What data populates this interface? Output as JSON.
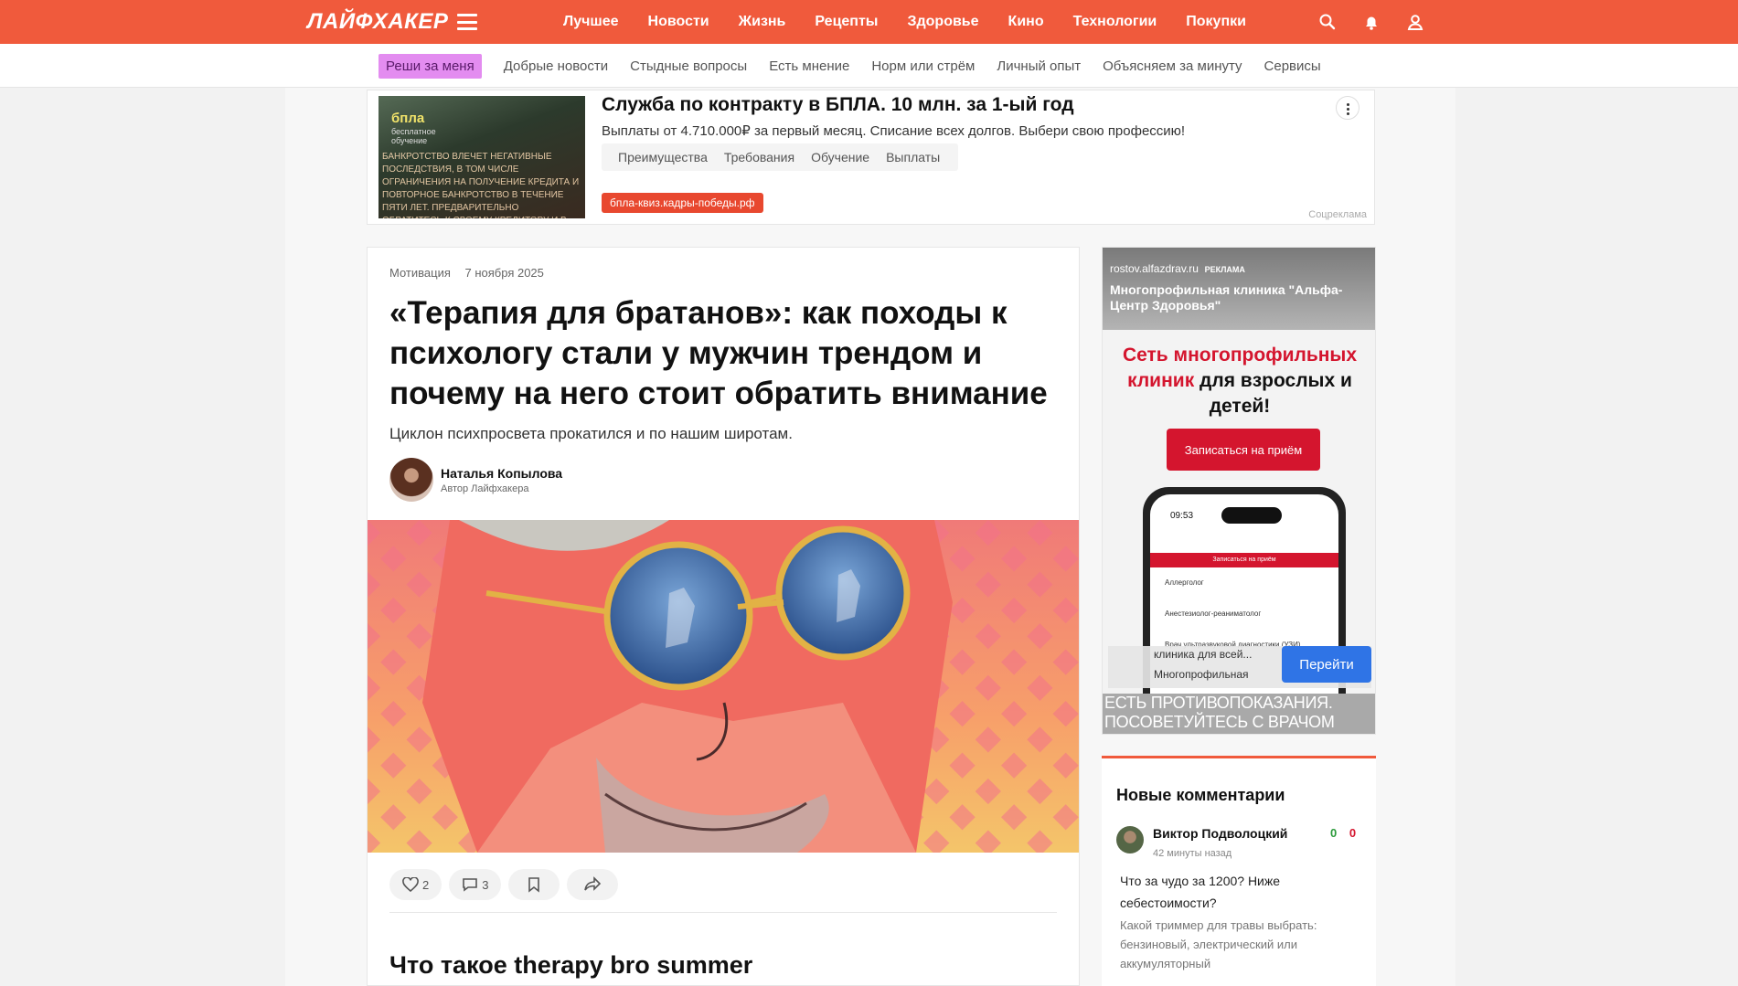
{
  "header": {
    "logo": "ЛАЙФХАКЕР",
    "nav": [
      "Лучшее",
      "Новости",
      "Жизнь",
      "Рецепты",
      "Здоровье",
      "Кино",
      "Технологии",
      "Покупки"
    ]
  },
  "subnav": {
    "highlight": "Реши за меня",
    "items": [
      "Добрые новости",
      "Стыдные вопросы",
      "Есть мнение",
      "Норм или стрём",
      "Личный опыт",
      "Объясняем за минуту",
      "Сервисы"
    ]
  },
  "top_ad": {
    "image_brand": "бпла",
    "image_brand_sub": "бесплатное обучение",
    "image_disclaimer": "БАНКРОТСТВО ВЛЕЧЕТ НЕГАТИВНЫЕ ПОСЛЕДСТВИЯ, В ТОМ ЧИСЛЕ ОГРАНИЧЕНИЯ НА ПОЛУЧЕНИЕ КРЕДИТА И ПОВТОРНОЕ БАНКРОТСТВО В ТЕЧЕНИЕ ПЯТИ ЛЕТ. ПРЕДВАРИТЕЛЬНО ОБРАТИТЕСЬ К СВОЕМУ КРЕДИТОРУ И В МФЦ",
    "title": "Служба по контракту в БПЛА. 10 млн. за 1-ый год",
    "description": "Выплаты от 4.710.000₽ за первый месяц. Списание всех долгов. Выбери свою профессию!",
    "tabs": [
      "Преимущества",
      "Требования",
      "Обучение",
      "Выплаты"
    ],
    "url": "бпла-квиз.кадры-победы.рф",
    "label": "Соцреклама"
  },
  "article": {
    "category": "Мотивация",
    "date": "7 ноября 2025",
    "title": "«Терапия для братанов»: как походы к психологу стали у мужчин трендом и почему на него стоит обратить внимание",
    "lead": "Циклон психпросвета прокатился и по нашим широтам.",
    "author_name": "Наталья Копылова",
    "author_role": "Автор Лайфхакера",
    "likes": "2",
    "comments": "3",
    "section_heading": "Что такое therapy bro summer"
  },
  "side_ad": {
    "site": "rostov.alfazdrav.ru",
    "ad_label": "РЕКЛАМА",
    "title": "Многопрофильная клиника \"Альфа-Центр Здоровья\"",
    "slogan_red": "Сеть многопрофильных клиник",
    "slogan_rest": "для взрослых и детей!",
    "button": "Записаться на приём",
    "phone_time": "09:53",
    "phone_bar": "Записаться на приём",
    "phone_rows": [
      "Аллерголог",
      "Анестезиолог-реаниматолог",
      "Врач ультразвуковой диагностики (УЗИ)"
    ],
    "goto_line1": "клиника для всей...",
    "goto_line2": "Многопрофильная",
    "goto_button": "Перейти",
    "warning": "ЕСТЬ ПРОТИВОПОКАЗАНИЯ. ПОСОВЕТУЙТЕСЬ С ВРАЧОМ"
  },
  "comments": {
    "heading": "Новые комментарии",
    "items": [
      {
        "author": "Виктор Подволоцкий",
        "time": "42 минуты назад",
        "plus": "0",
        "minus": "0",
        "text": "Что за чудо за 1200? Ниже себестоимости?",
        "topic": "Какой триммер для травы выбрать: бензиновый, электрический или аккумуляторный"
      }
    ]
  },
  "colors": {
    "brand": "#f05a3c",
    "ad_red": "#d4152e",
    "goto_blue": "#2f74e6"
  }
}
